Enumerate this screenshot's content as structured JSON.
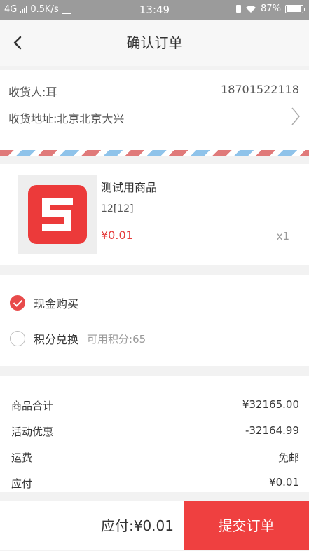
{
  "status_bar": {
    "network": "4G",
    "speed": "0.5K/s",
    "time": "13:49",
    "battery": "87%"
  },
  "nav": {
    "title": "确认订单"
  },
  "address": {
    "recipient": "收货人:耳",
    "phone": "18701522118",
    "address": "收货地址:北京北京大兴"
  },
  "product": {
    "name": "测试用商品",
    "spec": "12[12]",
    "price": "¥0.01",
    "quantity": "x1"
  },
  "payment": {
    "options": [
      {
        "label": "现金购买",
        "checked": true,
        "note": ""
      },
      {
        "label": "积分兑换",
        "checked": false,
        "note": "可用积分:65"
      }
    ]
  },
  "summary": {
    "rows": [
      {
        "label": "商品合计",
        "value": "¥32165.00"
      },
      {
        "label": "活动优惠",
        "value": "-32164.99"
      },
      {
        "label": "运费",
        "value": "免邮"
      },
      {
        "label": "应付",
        "value": "¥0.01"
      }
    ]
  },
  "footer": {
    "total": "应付:¥0.01",
    "submit": "提交订单"
  },
  "colors": {
    "accent": "#ef4040",
    "price": "#e53b3b"
  }
}
